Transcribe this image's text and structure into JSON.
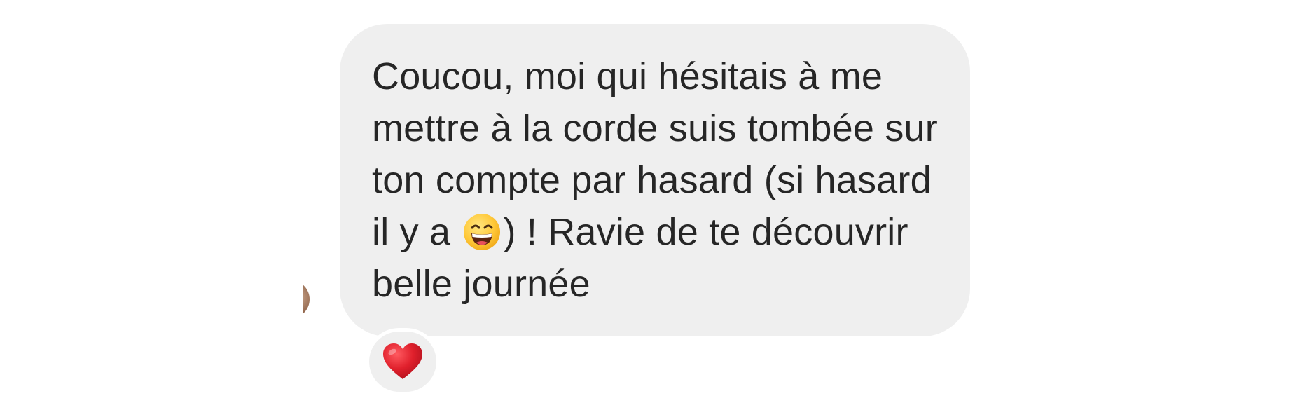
{
  "message": {
    "text_part1": "Coucou, moi qui hésitais à me mettre à la corde suis tombée sur ton compte par hasard (si hasard il y a ",
    "emoji": "grinning-face-with-smiling-eyes-emoji",
    "text_part2": ") ! Ravie de te découvrir belle journée"
  },
  "reaction": {
    "emoji": "red-heart-emoji",
    "color": "#e0202c"
  },
  "colors": {
    "bubble_background": "#efefef",
    "text": "#262626",
    "page_background": "#ffffff"
  }
}
